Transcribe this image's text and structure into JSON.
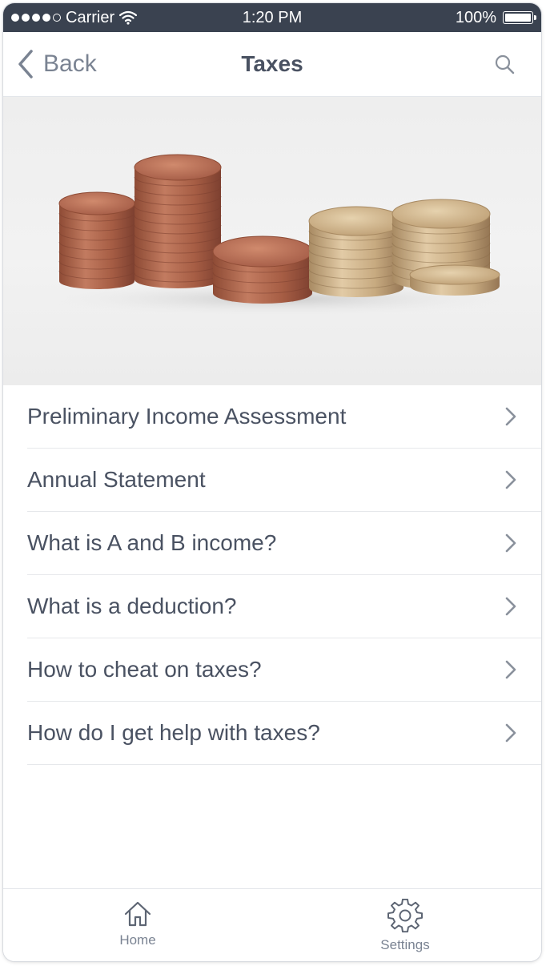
{
  "status_bar": {
    "carrier": "Carrier",
    "time": "1:20 PM",
    "battery": "100%",
    "signal_icon": "signal-dots-icon",
    "wifi_icon": "wifi-icon",
    "battery_icon": "battery-full-icon"
  },
  "nav": {
    "back_label": "Back",
    "title": "Taxes",
    "back_icon": "chevron-left-icon",
    "search_icon": "search-icon"
  },
  "hero": {
    "image": "stacks-of-coins-photo"
  },
  "list": {
    "items": [
      {
        "label": "Preliminary Income Assessment"
      },
      {
        "label": "Annual Statement"
      },
      {
        "label": "What is A and B income?"
      },
      {
        "label": "What is a deduction?"
      },
      {
        "label": "How to cheat on taxes?"
      },
      {
        "label": "How do I get help with taxes?"
      }
    ],
    "item_icon": "chevron-right-icon"
  },
  "tabbar": {
    "home_label": "Home",
    "settings_label": "Settings",
    "home_icon": "home-icon",
    "settings_icon": "gear-icon"
  },
  "colors": {
    "status_bar_bg": "#3a4250",
    "text": "#4a5262",
    "secondary_text": "#7a8392",
    "copper": "#b76f55",
    "brass": "#c9ad86"
  }
}
